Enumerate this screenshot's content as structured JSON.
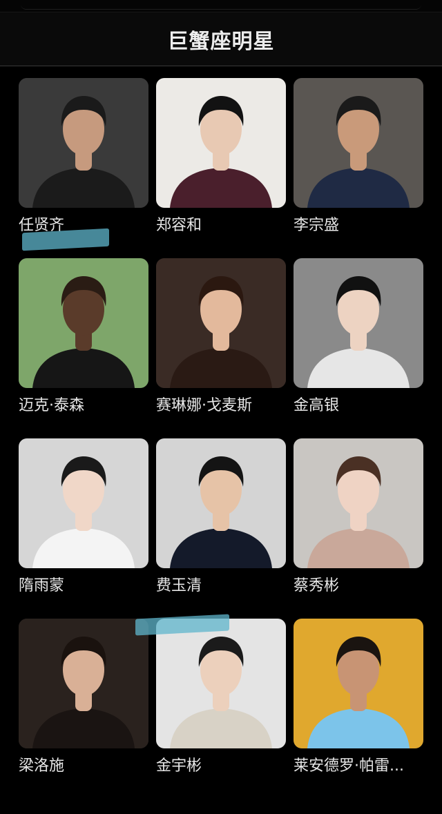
{
  "header": {
    "title": "巨蟹座明星"
  },
  "people": [
    {
      "name": "任贤齐",
      "bg": "#3a3a3a",
      "shirt": "#1b1b1b",
      "skin": "#c69a7e",
      "hair": "#1a1a1a"
    },
    {
      "name": "郑容和",
      "bg": "#eceae6",
      "shirt": "#4a1f2c",
      "skin": "#e8c9b3",
      "hair": "#121212"
    },
    {
      "name": "李宗盛",
      "bg": "#5a5652",
      "shirt": "#1f2a44",
      "skin": "#c99a7a",
      "hair": "#1a1a1a"
    },
    {
      "name": "迈克·泰森",
      "bg": "#7ea66a",
      "shirt": "#161616",
      "skin": "#5a3b2a",
      "hair": "#2a1c14"
    },
    {
      "name": "赛琳娜·戈麦斯",
      "bg": "#3a2b25",
      "shirt": "#2a1a14",
      "skin": "#e3b99c",
      "hair": "#2b1810"
    },
    {
      "name": "金高银",
      "bg": "#8a8a8a",
      "shirt": "#e6e6e6",
      "skin": "#edd3c2",
      "hair": "#111111"
    },
    {
      "name": "隋雨蒙",
      "bg": "#d6d6d6",
      "shirt": "#f4f4f4",
      "skin": "#f0d7c8",
      "hair": "#1a1a1a"
    },
    {
      "name": "费玉清",
      "bg": "#d4d4d4",
      "shirt": "#141a2a",
      "skin": "#e6c3a7",
      "hair": "#141414"
    },
    {
      "name": "蔡秀彬",
      "bg": "#c9c6c2",
      "shirt": "#c9a89a",
      "skin": "#efd3c4",
      "hair": "#4a3024"
    },
    {
      "name": "梁洛施",
      "bg": "#2a221e",
      "shirt": "#1a1412",
      "skin": "#d9b096",
      "hair": "#1a120e"
    },
    {
      "name": "金宇彬",
      "bg": "#e4e4e4",
      "shirt": "#d8d2c6",
      "skin": "#ecd0bc",
      "hair": "#1b1b1b"
    },
    {
      "name": "莱安德罗·帕雷...",
      "bg": "#e0a82e",
      "shirt": "#7cc4ea",
      "skin": "#c89474",
      "hair": "#1a1410"
    }
  ]
}
